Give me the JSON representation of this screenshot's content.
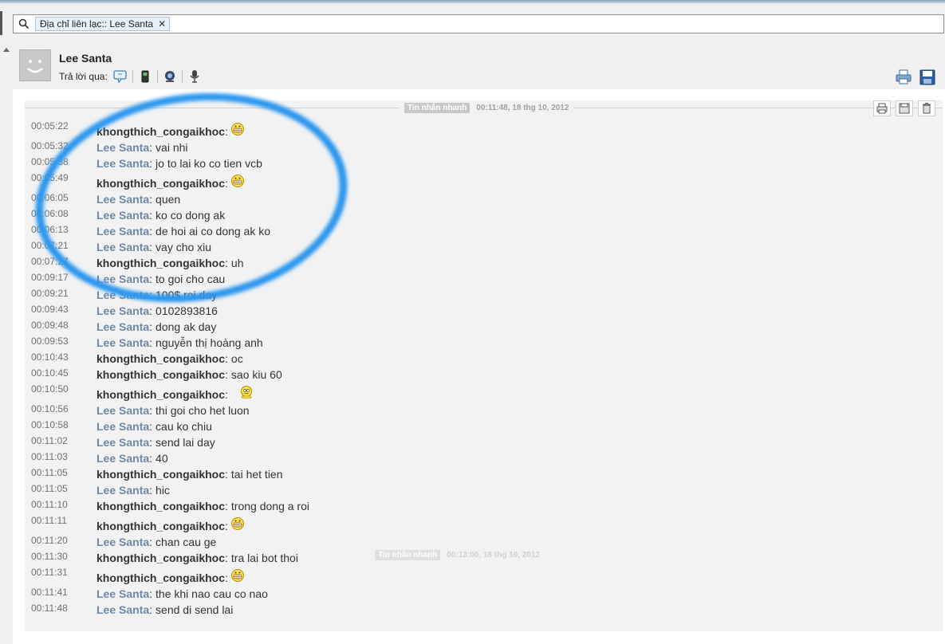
{
  "search": {
    "chip_label": "Địa chỉ liên lạc:: Lee Santa",
    "chip_close": "✕",
    "search_icon": "search-icon"
  },
  "contact": {
    "name": "Lee Santa",
    "reply_label": "Trả lời qua:",
    "reply_icons": [
      "chat-icon",
      "mobile-phone-icon",
      "webcam-icon",
      "microphone-icon"
    ],
    "header_actions": [
      "print-icon",
      "save-icon"
    ]
  },
  "session": {
    "tag": "Tin nhắn nhanh",
    "timestamp": "00:11:48, 18 thg 10, 2012",
    "tools": [
      "print-icon",
      "save-icon",
      "delete-icon"
    ]
  },
  "session_next": {
    "tag": "Tin nhắn nhanh",
    "timestamp": "00:13:00, 18 thg 10, 2012"
  },
  "sep": ":",
  "messages": [
    {
      "time": "00:05:22",
      "sender": "khongthich_congaikhoc",
      "who": "kh",
      "text": "",
      "emoticon": "grin"
    },
    {
      "time": "00:05:32",
      "sender": "Lee Santa",
      "who": "lee",
      "text": "vai nhi"
    },
    {
      "time": "00:05:38",
      "sender": "Lee Santa",
      "who": "lee",
      "text": "jo to lai ko co tien vcb"
    },
    {
      "time": "00:05:49",
      "sender": "khongthich_congaikhoc",
      "who": "kh",
      "text": "",
      "emoticon": "grin"
    },
    {
      "time": "00:06:05",
      "sender": "Lee Santa",
      "who": "lee",
      "text": "quen"
    },
    {
      "time": "00:06:08",
      "sender": "Lee Santa",
      "who": "lee",
      "text": "ko co dong ak"
    },
    {
      "time": "00:06:13",
      "sender": "Lee Santa",
      "who": "lee",
      "text": "de hoi ai co dong ak ko"
    },
    {
      "time": "00:07:21",
      "sender": "Lee Santa",
      "who": "lee",
      "text": "vay cho xiu"
    },
    {
      "time": "00:07:27",
      "sender": "khongthich_congaikhoc",
      "who": "kh",
      "text": "uh"
    },
    {
      "time": "00:09:17",
      "sender": "Lee Santa",
      "who": "lee",
      "text": "to goi cho cau"
    },
    {
      "time": "00:09:21",
      "sender": "Lee Santa",
      "who": "lee",
      "text": "100$ roi day"
    },
    {
      "time": "00:09:43",
      "sender": "Lee Santa",
      "who": "lee",
      "text": "0102893816"
    },
    {
      "time": "00:09:48",
      "sender": "Lee Santa",
      "who": "lee",
      "text": "dong ak day"
    },
    {
      "time": "00:09:53",
      "sender": "Lee Santa",
      "who": "lee",
      "text": "nguyễn thị hoàng anh"
    },
    {
      "time": "00:10:43",
      "sender": "khongthich_congaikhoc",
      "who": "kh",
      "text": "oc"
    },
    {
      "time": "00:10:45",
      "sender": "khongthich_congaikhoc",
      "who": "kh",
      "text": "sao kiu 60"
    },
    {
      "time": "00:10:50",
      "sender": "khongthich_congaikhoc",
      "who": "kh",
      "text": "",
      "emoticon": "thinking"
    },
    {
      "time": "00:10:56",
      "sender": "Lee Santa",
      "who": "lee",
      "text": "thi goi cho het luon"
    },
    {
      "time": "00:10:58",
      "sender": "Lee Santa",
      "who": "lee",
      "text": "cau ko chiu"
    },
    {
      "time": "00:11:02",
      "sender": "Lee Santa",
      "who": "lee",
      "text": "send lai day"
    },
    {
      "time": "00:11:03",
      "sender": "Lee Santa",
      "who": "lee",
      "text": "40"
    },
    {
      "time": "00:11:05",
      "sender": "khongthich_congaikhoc",
      "who": "kh",
      "text": "tai het tien"
    },
    {
      "time": "00:11:05",
      "sender": "Lee Santa",
      "who": "lee",
      "text": "hic"
    },
    {
      "time": "00:11:10",
      "sender": "khongthich_congaikhoc",
      "who": "kh",
      "text": "trong dong a roi"
    },
    {
      "time": "00:11:11",
      "sender": "khongthich_congaikhoc",
      "who": "kh",
      "text": "",
      "emoticon": "grin"
    },
    {
      "time": "00:11:20",
      "sender": "Lee Santa",
      "who": "lee",
      "text": "chan cau ge"
    },
    {
      "time": "00:11:30",
      "sender": "khongthich_congaikhoc",
      "who": "kh",
      "text": "tra lai bot thoi"
    },
    {
      "time": "00:11:31",
      "sender": "khongthich_congaikhoc",
      "who": "kh",
      "text": "",
      "emoticon": "grin"
    },
    {
      "time": "00:11:41",
      "sender": "Lee Santa",
      "who": "lee",
      "text": "the khi nao cau co nao"
    },
    {
      "time": "00:11:48",
      "sender": "Lee Santa",
      "who": "lee",
      "text": "send di send lai"
    }
  ],
  "colors": {
    "lee_sender": "#6e88a5",
    "kh_sender": "#333333",
    "highlight_circle": "#1e90ff",
    "chip_bg": "#e7f0f9"
  }
}
